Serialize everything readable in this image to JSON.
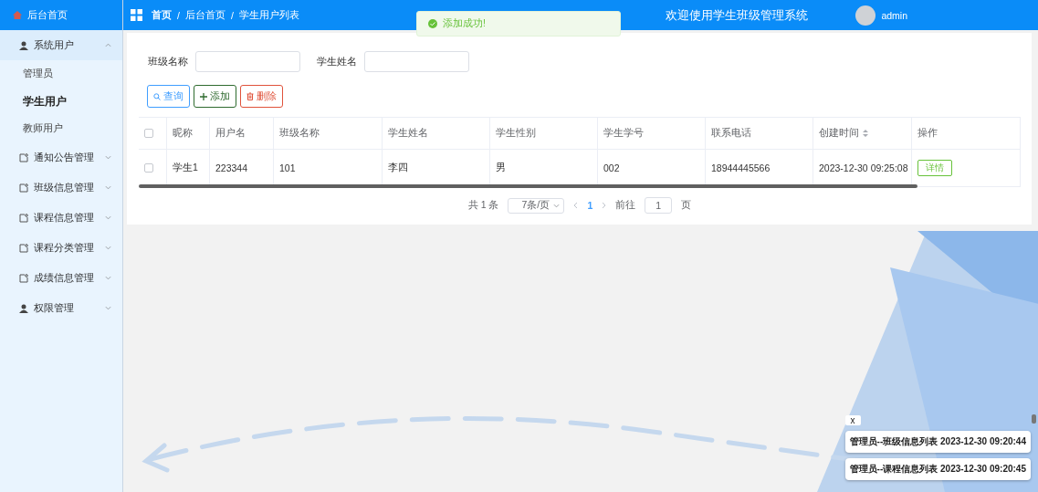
{
  "sidebar": {
    "home": "后台首页",
    "menus": [
      {
        "label": "系统用户",
        "kind": "user",
        "expanded": true,
        "children": [
          {
            "label": "管理员",
            "selected": false
          },
          {
            "label": "学生用户",
            "selected": true
          },
          {
            "label": "教师用户",
            "selected": false
          }
        ]
      },
      {
        "label": "通知公告管理",
        "kind": "doc",
        "expanded": false
      },
      {
        "label": "班级信息管理",
        "kind": "doc",
        "expanded": false
      },
      {
        "label": "课程信息管理",
        "kind": "doc",
        "expanded": false
      },
      {
        "label": "课程分类管理",
        "kind": "doc",
        "expanded": false
      },
      {
        "label": "成绩信息管理",
        "kind": "doc",
        "expanded": false
      },
      {
        "label": "权限管理",
        "kind": "user",
        "expanded": false
      }
    ]
  },
  "header": {
    "breadcrumbs": [
      "首页",
      "后台首页",
      "学生用户列表"
    ],
    "separator": "/",
    "title": "欢迎使用学生班级管理系统",
    "user": "admin"
  },
  "toast": {
    "message": "添加成功!"
  },
  "filters": [
    {
      "label": "班级名称"
    },
    {
      "label": "学生姓名"
    }
  ],
  "buttons": [
    {
      "label": "查询",
      "kind": "search"
    },
    {
      "label": "添加",
      "kind": "add"
    },
    {
      "label": "删除",
      "kind": "delete"
    }
  ],
  "table": {
    "select_all_checked": false,
    "columns": [
      {
        "label": "昵称",
        "sortable": false
      },
      {
        "label": "用户名",
        "sortable": false
      },
      {
        "label": "班级名称",
        "sortable": false
      },
      {
        "label": "学生姓名",
        "sortable": false
      },
      {
        "label": "学生性别",
        "sortable": false
      },
      {
        "label": "学生学号",
        "sortable": false
      },
      {
        "label": "联系电话",
        "sortable": false
      },
      {
        "label": "创建时间",
        "sortable": true
      }
    ],
    "action_column": "操作",
    "rows": [
      {
        "checked": false,
        "cells": [
          "学生1",
          "223344",
          "101",
          "李四",
          "男",
          "002",
          "18944445566",
          "2023-12-30 09:25:08"
        ],
        "action": "详情"
      }
    ]
  },
  "pagination": {
    "total": "共 1 条",
    "page_size": "7条/页",
    "pages": [
      {
        "label": "1",
        "selected": true
      }
    ],
    "goto_label": "前往",
    "goto_value": "1",
    "goto_suffix": "页"
  },
  "notifications": {
    "close": "x",
    "items": [
      "管理员--班级信息列表 2023-12-30 09:20:44",
      "管理员--课程信息列表 2023-12-30 09:20:45"
    ]
  }
}
